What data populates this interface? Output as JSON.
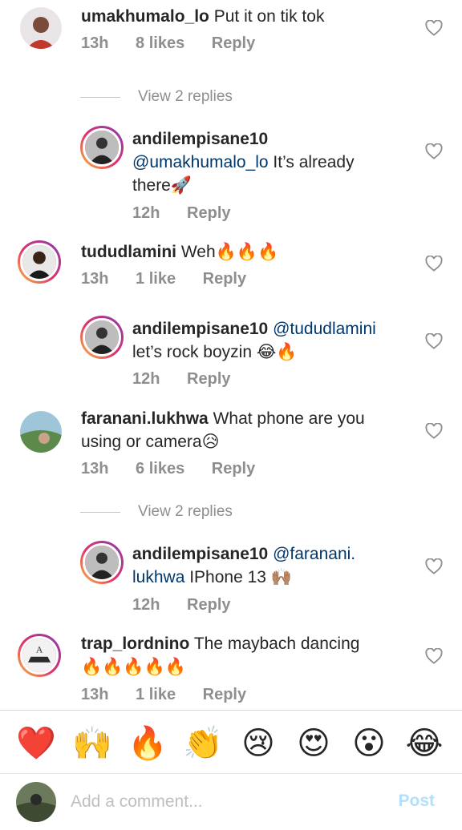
{
  "comments": [
    {
      "username": "umakhumalo_lo",
      "text": "Put it on tik tok",
      "time": "13h",
      "likes": "8 likes",
      "reply": "Reply"
    },
    {
      "view_replies": "View 2 replies"
    },
    {
      "username": "andilempisane10",
      "mention": "@umakhumalo_lo",
      "text_line1": "It’s already",
      "text_line2": "there🚀",
      "time": "12h",
      "reply": "Reply"
    },
    {
      "username": "tududlamini",
      "text": "Weh🔥🔥🔥",
      "time": "13h",
      "likes": "1 like",
      "reply": "Reply"
    },
    {
      "username": "andilempisane10",
      "mention": "@tududlamini",
      "text_line2": "let’s rock boyzin 😂🔥",
      "time": "12h",
      "reply": "Reply"
    },
    {
      "username": "faranani.lukhwa",
      "text_line1": "What phone are you",
      "text_line2": "using or camera😥",
      "time": "13h",
      "likes": "6 likes",
      "reply": "Reply"
    },
    {
      "view_replies": "View 2 replies"
    },
    {
      "username": "andilempisane10",
      "mention_line1": "@faranani.",
      "mention_line2": "lukhwa",
      "text_line2": "IPhone 13 🙌🏽",
      "time": "12h",
      "reply": "Reply"
    },
    {
      "username": "trap_lordnino",
      "text": "The maybach dancing",
      "text_line2": "🔥🔥🔥🔥🔥",
      "time": "13h",
      "likes": "1 like",
      "reply": "Reply"
    }
  ],
  "quick_reactions": [
    "❤️",
    "🙌",
    "🔥",
    "👏",
    "😢",
    "😍",
    "😮",
    "😂"
  ],
  "composer": {
    "placeholder": "Add a comment...",
    "post_label": "Post"
  },
  "colors": {
    "mention": "#00376b",
    "meta": "#8e8e8e",
    "post_disabled": "#b2dffc"
  }
}
